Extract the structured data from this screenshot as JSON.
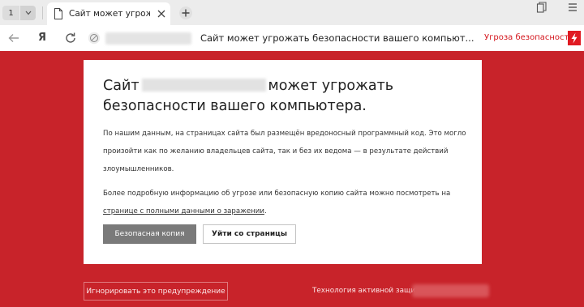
{
  "tabs": {
    "counter": "1",
    "active_title": "Сайт может угрожать б"
  },
  "addressbar": {
    "page_title": "Сайт может угрожать безопасности вашего компьют...",
    "threat_label": "Угроза безопасности"
  },
  "warning": {
    "heading_prefix": "Сайт",
    "heading_suffix": "может угрожать",
    "heading_line2": "безопасности вашего компьютера.",
    "paragraph1": "По нашим данным, на страницах сайта был размещён вредоносный программный код. Это могло произойти как по желанию владельцев сайта, так и без их ведома — в результате действий злоумышленников.",
    "paragraph2_text": "Более подробную информацию об угрозе или безопасную копию сайта можно посмотреть на",
    "paragraph2_link": "странице с полными данными о заражении",
    "paragraph2_end": ".",
    "safe_copy_label": "Безопасная копия",
    "leave_label": "Уйти со страницы"
  },
  "footer": {
    "ignore_label": "Игнорировать это предупреждение",
    "protect_label": "Технология активной защиты"
  },
  "colors": {
    "background": "#c8232a",
    "threat_red": "#d4161d",
    "safe_button": "#7a7a7a"
  },
  "icons": [
    "chevron-down-icon",
    "document-icon",
    "close-icon",
    "plus-icon",
    "bookmarks-icon",
    "menu-icon",
    "back-arrow-icon",
    "yandex-icon",
    "reload-icon",
    "site-info-icon",
    "lightning-icon"
  ]
}
